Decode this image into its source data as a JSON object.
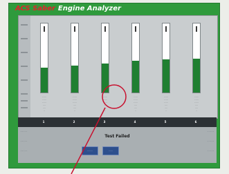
{
  "header": {
    "brand": "ACS Saber",
    "title": "Engine Analyzer"
  },
  "cylinders": [
    {
      "number": "1",
      "level": 0.36,
      "readings": [
        "- - -",
        "- - -",
        "- - -",
        "- -",
        "- -",
        "-"
      ]
    },
    {
      "number": "2",
      "level": 0.39,
      "readings": [
        "- - -",
        "- - -",
        "- - -",
        "- -",
        "- -",
        "-"
      ]
    },
    {
      "number": "3",
      "level": 0.42,
      "readings": [
        "- - -",
        "- - -",
        "- - -",
        "- -",
        "- -",
        "-"
      ]
    },
    {
      "number": "4",
      "level": 0.46,
      "readings": [
        "- - -",
        "- - -",
        "- - -",
        "- -",
        "- -",
        "-"
      ]
    },
    {
      "number": "5",
      "level": 0.48,
      "readings": [
        "- - -",
        "- - -",
        "- - -",
        "- -",
        "- -",
        "-"
      ]
    },
    {
      "number": "6",
      "level": 0.49,
      "readings": [
        "- - -",
        "- - -",
        "- - -",
        "- -",
        "- -",
        "-"
      ]
    }
  ],
  "status": "Test Failed",
  "left_labels": [
    "- - - - -",
    "- - - - -",
    "- - - - -"
  ],
  "right_labels": [
    "- - - - -",
    "- - - - -",
    "- - - - -"
  ],
  "buttons": {
    "primary": "- - - -",
    "secondary": "- - -"
  },
  "colors": {
    "frame": "#2f9a3c",
    "bar_fill": "#1f7f31",
    "brand_red": "#e0242c",
    "callout": "#c8102e"
  }
}
